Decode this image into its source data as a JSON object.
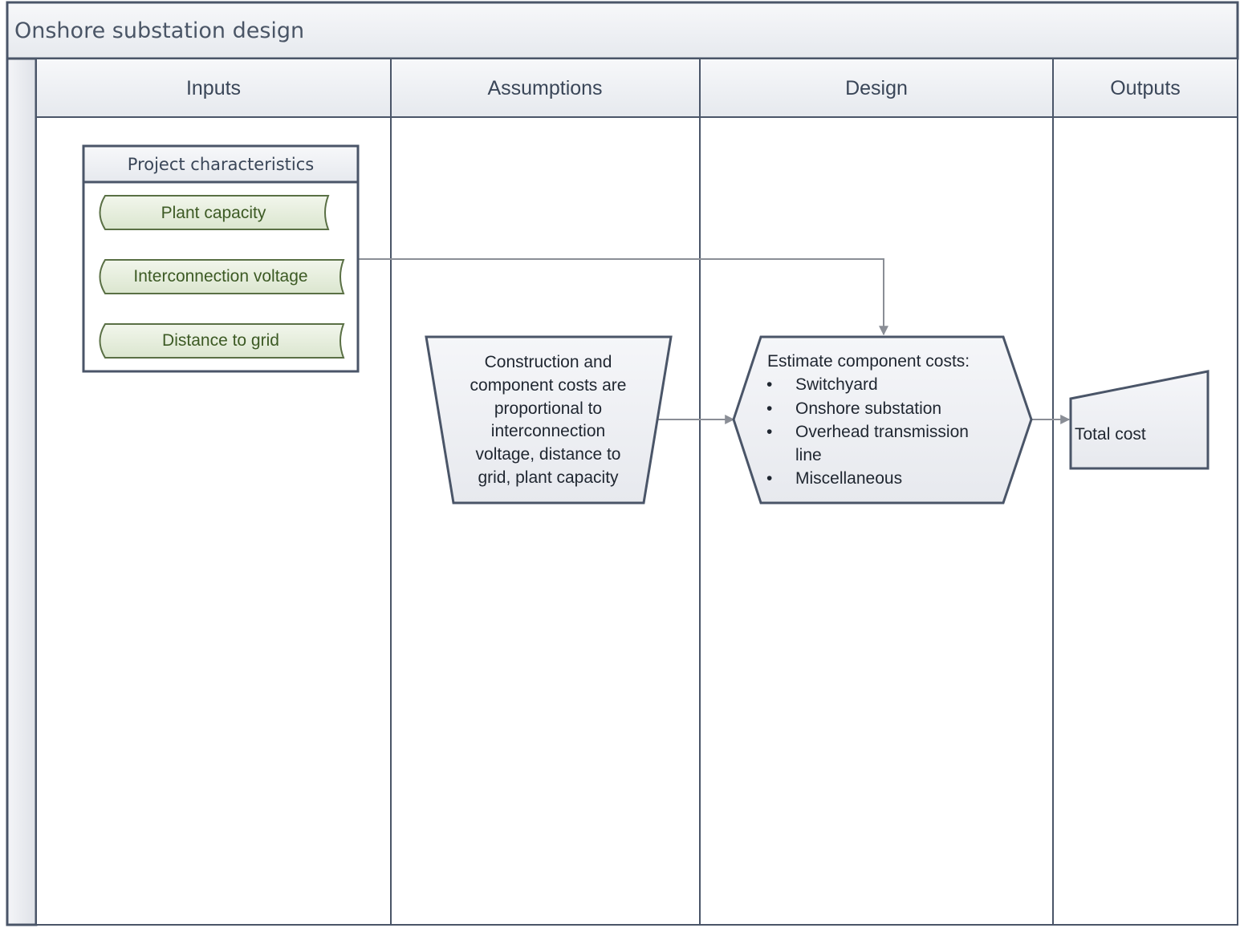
{
  "title": "Onshore substation design",
  "lanes": [
    {
      "label": "Inputs"
    },
    {
      "label": "Assumptions"
    },
    {
      "label": "Design"
    },
    {
      "label": "Outputs"
    }
  ],
  "inputs_group": {
    "title": "Project characteristics",
    "items": [
      "Plant capacity",
      "Interconnection voltage",
      "Distance to grid"
    ]
  },
  "assumption": {
    "lines": [
      "Construction and",
      "component costs are",
      "proportional to",
      "interconnection",
      "voltage, distance to",
      "grid, plant capacity"
    ]
  },
  "design": {
    "heading": "Estimate component costs:",
    "bullet_symbol": "•",
    "bullets": [
      "Switchyard",
      "Onshore substation",
      "Overhead transmission",
      "Miscellaneous"
    ],
    "bullet_continuation": "line"
  },
  "output": {
    "label": "Total cost"
  },
  "colors": {
    "border": "#4a5568",
    "header_fill": "#eef0f4",
    "input_fill": "#e9f0e1",
    "input_border": "#5a7045",
    "connector": "#8a8e96"
  }
}
